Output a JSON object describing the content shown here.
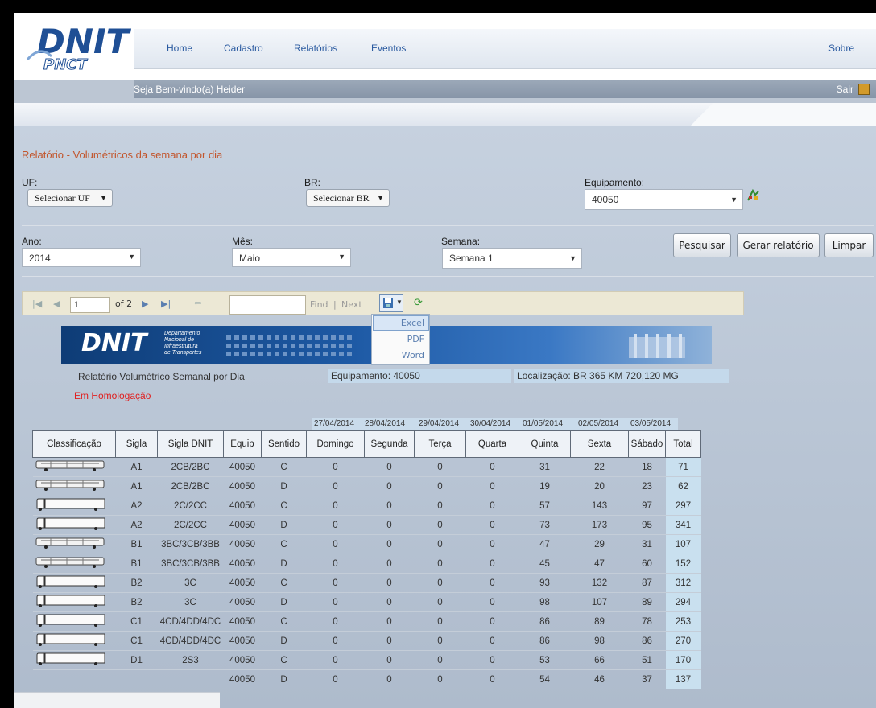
{
  "header": {
    "nav": {
      "home": "Home",
      "cadastro": "Cadastro",
      "relatorios": "Relatórios",
      "eventos": "Eventos",
      "sobre": "Sobre"
    },
    "welcome": "Seja Bem-vindo(a) Heider",
    "sair": "Sair"
  },
  "form": {
    "title": "Relatório - Volumétricos da semana por dia",
    "uf_label": "UF:",
    "uf_value": "Selecionar UF",
    "br_label": "BR:",
    "br_value": "Selecionar BR",
    "equip_label": "Equipamento:",
    "equip_value": "40050",
    "ano_label": "Ano:",
    "ano_value": "2014",
    "mes_label": "Mês:",
    "mes_value": "Maio",
    "semana_label": "Semana:",
    "semana_value": "Semana 1",
    "btn_pesquisar": "Pesquisar",
    "btn_gerar": "Gerar relatório",
    "btn_limpar": "Limpar"
  },
  "viewer": {
    "page": "1",
    "of": "of 2",
    "find": "Find",
    "sep": "|",
    "next": "Next",
    "export_options": [
      "Excel",
      "PDF",
      "Word"
    ]
  },
  "report": {
    "banner_logo": "DNIT",
    "banner_sub": [
      "Departamento",
      "Nacional de",
      "Infraestrutura",
      "de Transportes"
    ],
    "title": "Relatório Volumétrico Semanal por Dia",
    "equipamento": "Equipamento: 40050",
    "localizacao": "Localização: BR 365 KM 720,120 MG",
    "homologacao": "Em Homologação",
    "dates": [
      "27/04/2014",
      "28/04/2014",
      "29/04/2014",
      "30/04/2014",
      "01/05/2014",
      "02/05/2014",
      "03/05/2014"
    ],
    "headers": [
      "Classificação",
      "Sigla",
      "Sigla DNIT",
      "Equip",
      "Sentido",
      "Domingo",
      "Segunda",
      "Terça",
      "Quarta",
      "Quinta",
      "Sexta",
      "Sábado",
      "Total"
    ],
    "rows": [
      [
        "bus",
        "A1",
        "2CB/2BC",
        "40050",
        "C",
        "0",
        "0",
        "0",
        "0",
        "31",
        "22",
        "18",
        "71"
      ],
      [
        "bus",
        "A1",
        "2CB/2BC",
        "40050",
        "D",
        "0",
        "0",
        "0",
        "0",
        "19",
        "20",
        "23",
        "62"
      ],
      [
        "truck",
        "A2",
        "2C/2CC",
        "40050",
        "C",
        "0",
        "0",
        "0",
        "0",
        "57",
        "143",
        "97",
        "297"
      ],
      [
        "truck",
        "A2",
        "2C/2CC",
        "40050",
        "D",
        "0",
        "0",
        "0",
        "0",
        "73",
        "173",
        "95",
        "341"
      ],
      [
        "bus",
        "B1",
        "3BC/3CB/3BB",
        "40050",
        "C",
        "0",
        "0",
        "0",
        "0",
        "47",
        "29",
        "31",
        "107"
      ],
      [
        "bus",
        "B1",
        "3BC/3CB/3BB",
        "40050",
        "D",
        "0",
        "0",
        "0",
        "0",
        "45",
        "47",
        "60",
        "152"
      ],
      [
        "truck",
        "B2",
        "3C",
        "40050",
        "C",
        "0",
        "0",
        "0",
        "0",
        "93",
        "132",
        "87",
        "312"
      ],
      [
        "truck",
        "B2",
        "3C",
        "40050",
        "D",
        "0",
        "0",
        "0",
        "0",
        "98",
        "107",
        "89",
        "294"
      ],
      [
        "truck",
        "C1",
        "4CD/4DD/4DC",
        "40050",
        "C",
        "0",
        "0",
        "0",
        "0",
        "86",
        "89",
        "78",
        "253"
      ],
      [
        "truck",
        "C1",
        "4CD/4DD/4DC",
        "40050",
        "D",
        "0",
        "0",
        "0",
        "0",
        "86",
        "98",
        "86",
        "270"
      ],
      [
        "truck",
        "D1",
        "2S3",
        "40050",
        "C",
        "0",
        "0",
        "0",
        "0",
        "53",
        "66",
        "51",
        "170"
      ],
      [
        "",
        "",
        "",
        "40050",
        "D",
        "0",
        "0",
        "0",
        "0",
        "54",
        "46",
        "37",
        "137"
      ]
    ]
  }
}
